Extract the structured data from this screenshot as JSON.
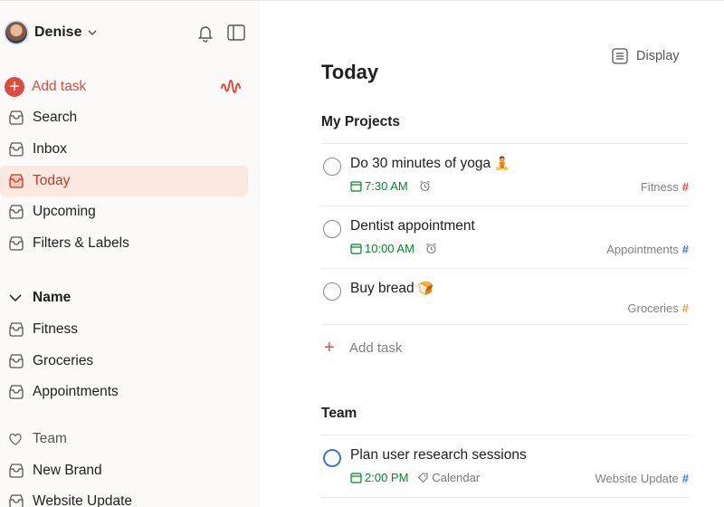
{
  "sidebar": {
    "user_name": "Denise",
    "add_task": "Add task",
    "nav": [
      {
        "label": "Search",
        "icon": "search-icon"
      },
      {
        "label": "Inbox",
        "icon": "inbox-icon"
      },
      {
        "label": "Today",
        "icon": "today-icon",
        "active": true
      },
      {
        "label": "Upcoming",
        "icon": "upcoming-icon"
      },
      {
        "label": "Filters & Labels",
        "icon": "filters-icon"
      }
    ],
    "section_name": "Name",
    "projects": [
      {
        "label": "Fitness"
      },
      {
        "label": "Groceries"
      },
      {
        "label": "Appointments"
      }
    ],
    "team_label": "Team",
    "team_projects": [
      {
        "label": "New Brand"
      },
      {
        "label": "Website Update"
      }
    ]
  },
  "main": {
    "display_label": "Display",
    "title": "Today",
    "groups": [
      {
        "title": "My Projects",
        "tasks": [
          {
            "title": "Do 30 minutes of yoga",
            "emoji": "🧘",
            "time": "7:30 AM",
            "alarm": true,
            "project": "Fitness",
            "hash_color": "#dc4c3e"
          },
          {
            "title": "Dentist appointment",
            "time": "10:00 AM",
            "alarm": true,
            "project": "Appointments",
            "hash_color": "#4073d6"
          },
          {
            "title": "Buy bread",
            "emoji": "🍞",
            "project": "Groceries",
            "hash_color": "#e0a23a"
          }
        ],
        "add_task": "Add task"
      },
      {
        "title": "Team",
        "tasks": [
          {
            "title": "Plan user research sessions",
            "time": "2:00 PM",
            "tag": "Calendar",
            "project": "Website Update",
            "hash_color": "#4073d6"
          }
        ]
      }
    ]
  },
  "colors": {
    "accent": "#dc4c3e",
    "time_green": "#058527",
    "active_bg": "#fbe9e1"
  }
}
